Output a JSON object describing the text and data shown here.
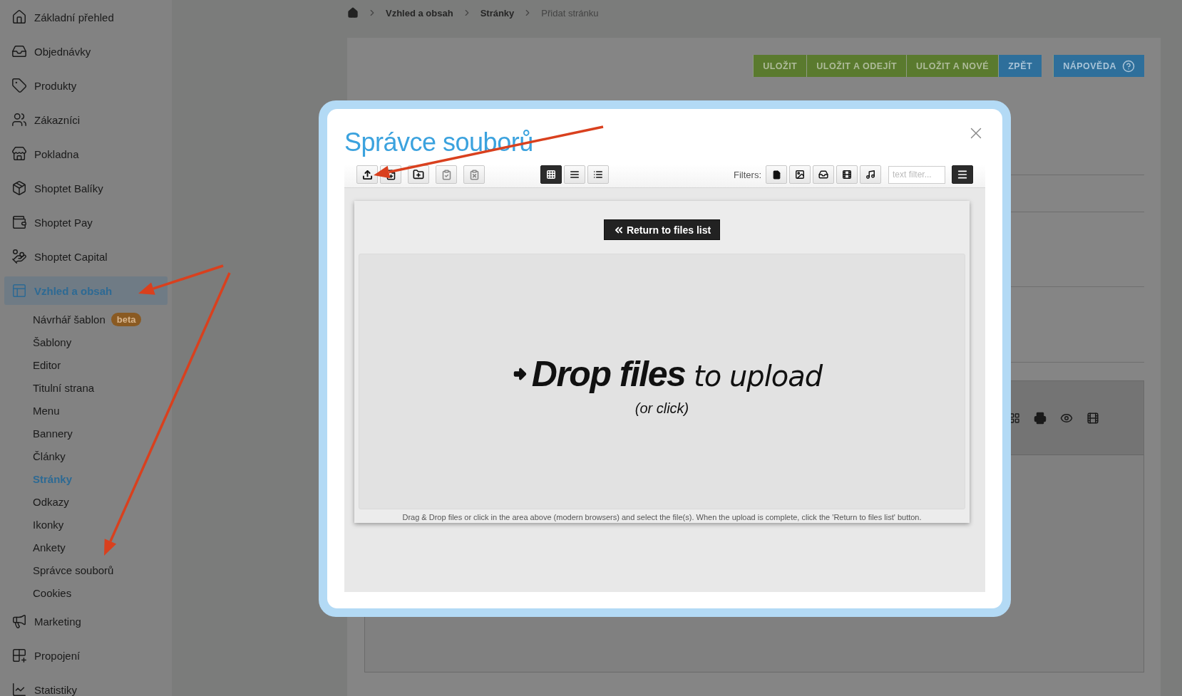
{
  "breadcrumbs": [
    {
      "label": "Vzhled a obsah",
      "current": false
    },
    {
      "label": "Stránky",
      "current": false
    },
    {
      "label": "Přidat stránku",
      "current": true
    }
  ],
  "actions": [
    {
      "label": "ULOŽIT",
      "kind": "save"
    },
    {
      "label": "ULOŽIT A ODEJÍT",
      "kind": "save"
    },
    {
      "label": "ULOŽIT A NOVÉ",
      "kind": "save"
    },
    {
      "label": "ZPĚT",
      "kind": "back"
    },
    {
      "label": "NÁPOVĚDA",
      "kind": "help"
    }
  ],
  "sidebar": {
    "items": [
      {
        "label": "Základní přehled",
        "selected": false
      },
      {
        "label": "Objednávky",
        "selected": false
      },
      {
        "label": "Produkty",
        "selected": false
      },
      {
        "label": "Zákazníci",
        "selected": false
      },
      {
        "label": "Pokladna",
        "selected": false
      },
      {
        "label": "Shoptet Balíky",
        "selected": false
      },
      {
        "label": "Shoptet Pay",
        "selected": false
      },
      {
        "label": "Shoptet Capital",
        "selected": false
      },
      {
        "label": "Vzhled a obsah",
        "selected": true,
        "children": [
          {
            "label": "Návrhář šablon",
            "badge": "beta",
            "selected": false
          },
          {
            "label": "Šablony",
            "selected": false
          },
          {
            "label": "Editor",
            "selected": false
          },
          {
            "label": "Titulní strana",
            "selected": false
          },
          {
            "label": "Menu",
            "selected": false
          },
          {
            "label": "Bannery",
            "selected": false
          },
          {
            "label": "Články",
            "selected": false
          },
          {
            "label": "Stránky",
            "selected": true
          },
          {
            "label": "Odkazy",
            "selected": false
          },
          {
            "label": "Ikonky",
            "selected": false
          },
          {
            "label": "Ankety",
            "selected": false
          },
          {
            "label": "Správce souborů",
            "selected": false
          },
          {
            "label": "Cookies",
            "selected": false
          }
        ]
      },
      {
        "label": "Marketing",
        "selected": false
      },
      {
        "label": "Propojení",
        "selected": false
      },
      {
        "label": "Statistiky",
        "selected": false
      }
    ]
  },
  "dialog": {
    "title": "Správce souborů",
    "toolbar": {
      "views": [
        {
          "selected": true
        },
        {
          "selected": false
        },
        {
          "selected": false
        }
      ],
      "filters_label": "Filters:",
      "text_filter": {
        "placeholder": "text filter..."
      }
    },
    "return_button": "Return to files list",
    "drop_zone": {
      "headline": "**Drop files** to upload",
      "hint": "(or click)"
    },
    "caption": "Drag & Drop files or click in the area above (modern browsers) and select the file(s). When the upload is complete, click the 'Return to files list' button."
  }
}
